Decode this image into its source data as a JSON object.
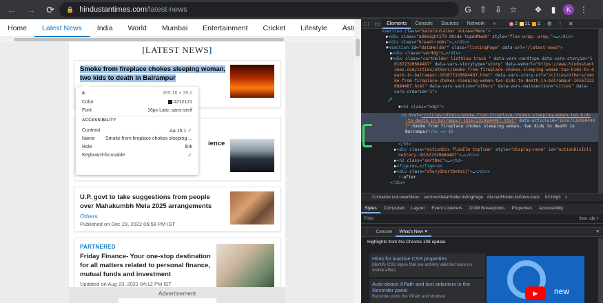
{
  "browser": {
    "url_host": "hindustantimes.com",
    "url_path": "/latest-news",
    "profile_initial": "K"
  },
  "site": {
    "nav": [
      "Home",
      "Latest News",
      "India",
      "World",
      "Mumbai",
      "Entertainment",
      "Cricket",
      "Lifestyle",
      "Astrolo"
    ],
    "active_nav": "Latest News",
    "section_title": "LATEST NEWS",
    "articles": [
      {
        "title": "Smoke from fireplace chokes sleeping woman, two kids to death in Balrampur"
      },
      {
        "title_partial": "ience"
      },
      {
        "title": "U.P. govt to take suggestions from people over Mahakumbh Mela 2025 arrangements",
        "section": "Others",
        "published": "Published on Dec 29, 2022 06:58 PM IST"
      },
      {
        "label": "PARTNERED",
        "title": "Friday Finance- Your one-stop destination for all matters related to personal finance, mutual funds and investment",
        "updated": "Updated on Aug 23, 2021 04:12 PM IST"
      }
    ],
    "advertisement": "Advertisement"
  },
  "tooltip": {
    "tag": "a",
    "size": "365.16 × 39.2",
    "color_label": "Color",
    "color_value": "#212121",
    "font_label": "Font",
    "font_value": "16px Lato, sans-serif",
    "accessibility": "ACCESSIBILITY",
    "contrast_label": "Contrast",
    "contrast_value": "16.1",
    "contrast_aa": "Aa",
    "name_label": "Name",
    "name_value": "Smoke from fireplace chokes sleeping ...",
    "role_label": "Role",
    "role_value": "link",
    "keyboard_label": "Keyboard-focusable"
  },
  "devtools": {
    "tabs": [
      "Elements",
      "Console",
      "Sources",
      "Network"
    ],
    "active_tab": "Elements",
    "more": "»",
    "errors": "2",
    "warnings": "21",
    "info": "1",
    "breadcrumbs": [
      "...",
      ".Container.noLowerMenu",
      "section#dataHolder.listingPage",
      "div.cartHolder.listView.track.",
      "h3.hdg3",
      ">"
    ],
    "style_tabs": [
      "Styles",
      "Computed",
      "Layout",
      "Event Listeners",
      "DOM Breakpoints",
      "Properties",
      "Accessibility"
    ],
    "filter_placeholder": "Filter",
    "filter_tools": ":hov  .cls  +",
    "drawer_tabs": [
      "Console",
      "What's New"
    ],
    "highlights": "Highlights from the Chrome 108 update",
    "whatsnew": [
      {
        "title": "Hints for inactive CSS properties",
        "desc": "Identify CSS styles that are entirely valid but have no visible effect."
      },
      {
        "title": "Auto-detect XPath and text selectors in the Recorder panel",
        "desc": "Recorder picks the XPath and shortest"
      }
    ],
    "video_label": "new"
  },
  "colors": {
    "accent": "#0a7ac4",
    "devtools_bg": "#202124",
    "selection": "#404a5a"
  }
}
